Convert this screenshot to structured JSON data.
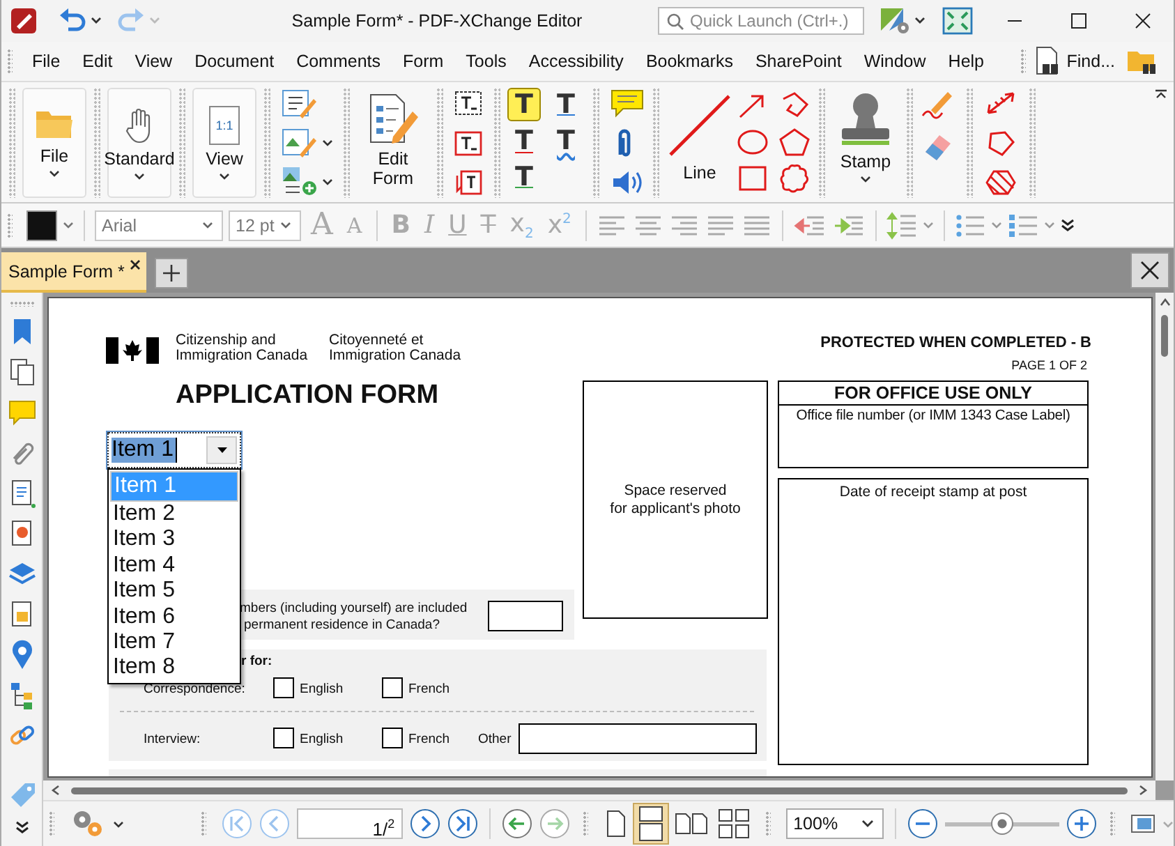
{
  "window": {
    "title": "Sample Form* - PDF-XChange Editor"
  },
  "quick_launch": {
    "placeholder": "Quick Launch (Ctrl+.)"
  },
  "menu": [
    "File",
    "Edit",
    "View",
    "Document",
    "Comments",
    "Form",
    "Tools",
    "Accessibility",
    "Bookmarks",
    "SharePoint",
    "Window",
    "Help"
  ],
  "find": "Find...",
  "ribbon": {
    "file": "File",
    "standard": "Standard",
    "view": "View",
    "view_icon_text": "1:1",
    "edit_form": "Edit Form",
    "text_tools": [
      "T",
      "T",
      "T",
      "T",
      "T"
    ],
    "line": "Line",
    "stamp": "Stamp"
  },
  "format_bar": {
    "font": "Arial",
    "size": "12 pt",
    "font_size_buttons": [
      "A",
      "A"
    ],
    "style_buttons": [
      "B",
      "I",
      "U",
      "T",
      "x$_{2}$",
      "x$^{2}$"
    ]
  },
  "tabs": [
    {
      "label": "Sample Form *",
      "selected": true
    }
  ],
  "document": {
    "agency_en": "Citizenship and Immigration Canada",
    "agency_fr": "Citoyenneté et Immigration Canada",
    "protected": "PROTECTED WHEN COMPLETED - B",
    "page_label": "PAGE 1 OF 2",
    "form_title": "APPLICATION FORM",
    "photo_label": [
      "Space reserved",
      "for applicant's photo"
    ],
    "office_heading": "FOR OFFICE USE ONLY",
    "office_file_label": "Office file number (or IMM 1343 Case Label)",
    "receipt_label": "Date of receipt stamp at post",
    "question_lines": [
      "mbers (including yourself) are included",
      "permanent residence in Canada?"
    ],
    "section_label": "r for:",
    "correspondence_label": "Correspondence:",
    "interview_label": "Interview:",
    "other_label": "Other",
    "correspondence_options": [
      {
        "label": "English",
        "checked": false
      },
      {
        "label": "French",
        "checked": false
      }
    ],
    "interview_options": [
      {
        "label": "English",
        "checked": false
      },
      {
        "label": "French",
        "checked": false
      }
    ],
    "dropdown": {
      "value": "Item 1",
      "expanded": true,
      "items": [
        {
          "label": "Item 1",
          "selected": true
        },
        {
          "label": "Item 2",
          "selected": false
        },
        {
          "label": "Item 3",
          "selected": false
        },
        {
          "label": "Item 4",
          "selected": false
        },
        {
          "label": "Item 5",
          "selected": false
        },
        {
          "label": "Item 6",
          "selected": false
        },
        {
          "label": "Item 7",
          "selected": false
        },
        {
          "label": "Item 8",
          "selected": false
        }
      ]
    }
  },
  "page_nav": {
    "page": "1/$^{2}$",
    "zoom": "100%",
    "zoom_slider": {
      "level": 0.5
    }
  }
}
